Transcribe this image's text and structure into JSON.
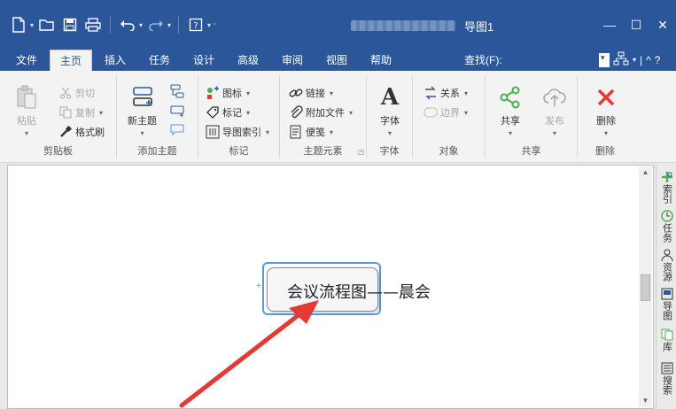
{
  "window": {
    "title": "导图1",
    "minimize": "—",
    "maximize": "☐",
    "close": "✕"
  },
  "qat": {
    "items": [
      "new-icon",
      "open-icon",
      "save-icon",
      "print-icon",
      "undo-icon",
      "redo-icon",
      "help-icon",
      "customize-icon"
    ]
  },
  "tabs": [
    {
      "label": "文件",
      "active": false
    },
    {
      "label": "主页",
      "active": true
    },
    {
      "label": "插入",
      "active": false
    },
    {
      "label": "任务",
      "active": false
    },
    {
      "label": "设计",
      "active": false
    },
    {
      "label": "高级",
      "active": false
    },
    {
      "label": "审阅",
      "active": false
    },
    {
      "label": "视图",
      "active": false
    },
    {
      "label": "帮助",
      "active": false
    }
  ],
  "find": {
    "label": "查找(F):"
  },
  "tab_right": {
    "caret_up": "^",
    "help": "?"
  },
  "ribbon": {
    "clipboard": {
      "label": "剪贴板",
      "paste": "粘贴",
      "cut": "剪切",
      "copy": "复制",
      "format_painter": "格式刷"
    },
    "add_topic": {
      "label": "添加主题",
      "new_topic": "新主题"
    },
    "markers": {
      "label": "标记",
      "icon": "图标",
      "tag": "标记",
      "map_index": "导图索引"
    },
    "topic_elements": {
      "label": "主题元素",
      "link": "链接",
      "attach": "附加文件",
      "note": "便笺"
    },
    "font": {
      "label": "字体",
      "font": "字体",
      "glyph": "A"
    },
    "objects": {
      "label": "对象",
      "relation": "关系",
      "boundary": "边界"
    },
    "share": {
      "label": "共享",
      "share": "共享",
      "publish": "发布"
    },
    "delete": {
      "label": "删除",
      "delete": "删除"
    }
  },
  "canvas": {
    "central_topic": "会议流程图——晨会",
    "add_symbol": "+"
  },
  "side_panel": {
    "items": [
      {
        "label": "索引",
        "icon": "index-icon"
      },
      {
        "label": "任务",
        "icon": "task-icon"
      },
      {
        "label": "资源",
        "icon": "resource-icon"
      },
      {
        "label": "导图",
        "icon": "map-icon"
      },
      {
        "label": "库",
        "icon": "library-icon"
      },
      {
        "label": "搜索",
        "icon": "search-icon"
      }
    ]
  },
  "colors": {
    "titlebar": "#2b579a",
    "accent_red": "#e53935",
    "share_green": "#4caf50",
    "selection_blue": "#5b9bd5"
  }
}
